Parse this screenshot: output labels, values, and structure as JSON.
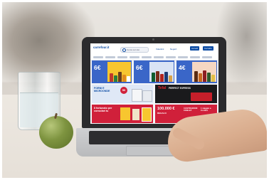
{
  "website": {
    "logo": "carrefour.it",
    "search": {
      "placeholder": "Cerca sul sito"
    },
    "header_links": [
      "Volantini",
      "Negozi"
    ],
    "account_buttons": [
      "Accedi",
      "Carrello"
    ],
    "nav_count": 10
  },
  "banners": [
    {
      "price": "6€",
      "bg": "#3a66c8"
    },
    {
      "price": "6€",
      "bg": "#3a66c8"
    },
    {
      "price": "4€",
      "bg": "#3a66c8"
    }
  ],
  "promos": {
    "lavatrice": {
      "text": "FORNI E MICROONDE",
      "badge": "50"
    },
    "tefal": {
      "brand": "Tefal",
      "text": "PERFECT EXPRESS"
    },
    "fortunato": {
      "text": "Il fortunato per consolari tu"
    },
    "sconto": {
      "big": "100.000 €",
      "small": "REGALO",
      "text": "3 ESTRAZIONI COBLET",
      "extra": "1 viaggio a Cortina"
    }
  },
  "colors": {
    "brand_blue": "#0a4aa3",
    "banner_blue": "#3a66c8",
    "promo_red": "#d0203a",
    "promo_yellow": "#f7c62f"
  }
}
